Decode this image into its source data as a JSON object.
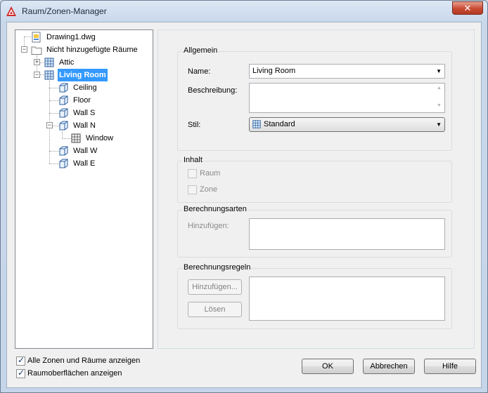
{
  "window": {
    "title": "Raum/Zonen-Manager",
    "close_glyph": "✕"
  },
  "tree": {
    "items": [
      {
        "label": "Drawing1.dwg",
        "icon": "drawing-file-icon"
      },
      {
        "label": "Nicht hinzugefügte Räume",
        "icon": "folder-icon",
        "expander": "−"
      },
      {
        "label": "Attic",
        "icon": "space-icon",
        "expander": "+"
      },
      {
        "label": "Living Room",
        "icon": "space-icon",
        "expander": "−",
        "selected": true
      },
      {
        "label": "Ceiling",
        "icon": "surface-icon"
      },
      {
        "label": "Floor",
        "icon": "surface-icon"
      },
      {
        "label": "Wall S",
        "icon": "surface-icon"
      },
      {
        "label": "Wall N",
        "icon": "surface-icon",
        "expander": "−"
      },
      {
        "label": "Window",
        "icon": "opening-icon"
      },
      {
        "label": "Wall W",
        "icon": "surface-icon"
      },
      {
        "label": "Wall E",
        "icon": "surface-icon"
      }
    ]
  },
  "allgemein": {
    "title": "Allgemein",
    "name_label": "Name:",
    "name_value": "Living Room",
    "beschreibung_label": "Beschreibung:",
    "beschreibung_value": "",
    "stil_label": "Stil:",
    "stil_value": "Standard"
  },
  "inhalt": {
    "title": "Inhalt",
    "raum_label": "Raum",
    "zone_label": "Zone",
    "raum_checked": false,
    "zone_checked": false
  },
  "berechnungsarten": {
    "title": "Berechnungsarten",
    "hinzufuegen_label": "Hinzufügen:"
  },
  "berechnungsregeln": {
    "title": "Berechnungsregeln",
    "add_button": "Hinzufügen...",
    "delete_button": "Lösen"
  },
  "footer": {
    "show_all_label": "Alle Zonen und Räume anzeigen",
    "show_all_checked": true,
    "show_surfaces_label": "Raumoberflächen anzeigen",
    "show_surfaces_checked": true,
    "ok_button": "OK",
    "cancel_button": "Abbrechen",
    "help_button": "Hilfe"
  },
  "colors": {
    "selection": "#3399ff",
    "title_bar": "#c8d7ea",
    "close_button": "#c84a33"
  }
}
